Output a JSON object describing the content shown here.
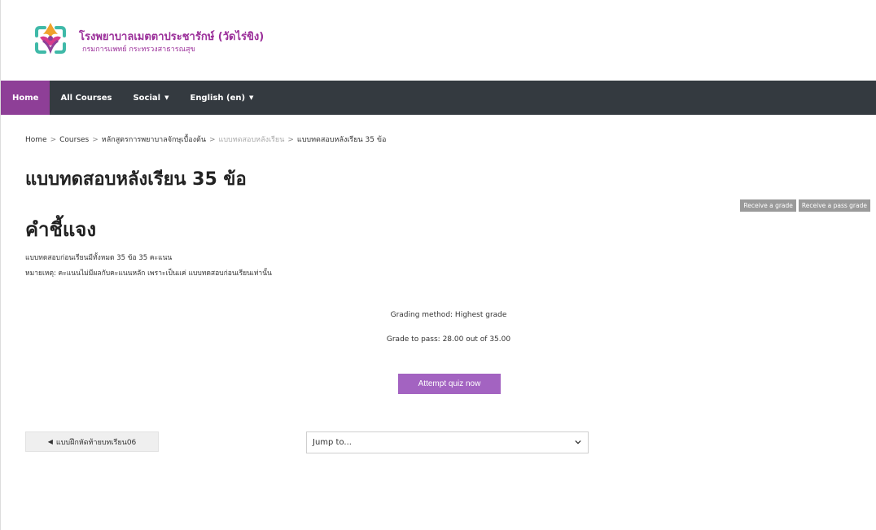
{
  "header": {
    "hospital_name": "โรงพยาบาลเมตตาประชารักษ์ (วัดไร่ขิง)",
    "hospital_sub": "กรมการแพทย์ กระทรวงสาธารณสุข",
    "logo_icon": "hospital-logo-icon",
    "brand_color": "#9b2f9a"
  },
  "navbar": {
    "background": "#343a40",
    "active_color": "#8e3f97",
    "items": [
      {
        "label": "Home",
        "active": true
      },
      {
        "label": "All Courses"
      },
      {
        "label": "Social",
        "dropdown": true
      },
      {
        "label": "English (en)",
        "dropdown": true
      }
    ]
  },
  "breadcrumb": {
    "items": [
      "Home",
      "Courses",
      "หลักสูตรการพยาบาลจักษุเบื้องต้น",
      "แบบทดสอบหลังเรียน",
      "แบบทดสอบหลังเรียน 35 ข้อ"
    ]
  },
  "page": {
    "title": "แบบทดสอบหลังเรียน 35 ข้อ",
    "badges": [
      "Receive a grade",
      "Receive a pass grade"
    ],
    "section_title": "คำชี้แจง",
    "desc_line1": "แบบทดสอบก่อนเรียนมีทั้งหมด 35 ข้อ  35 คะแนน",
    "desc_line2": "หมายเหตุ: คะแนนไม่มีผลกับคะแนนหลัก เพราะเป็นแค่ แบบทดสอบก่อนเรียนเท่านั้น",
    "grading_method": "Grading method: Highest grade",
    "grade_to_pass": "Grade to pass: 28.00 out of 35.00",
    "attempt_button": "Attempt quiz now",
    "attempt_color": "#a363c1"
  },
  "footer_nav": {
    "prev_label": "แบบฝึกหัดท้ายบทเรียน06",
    "jump_placeholder": "Jump to..."
  }
}
